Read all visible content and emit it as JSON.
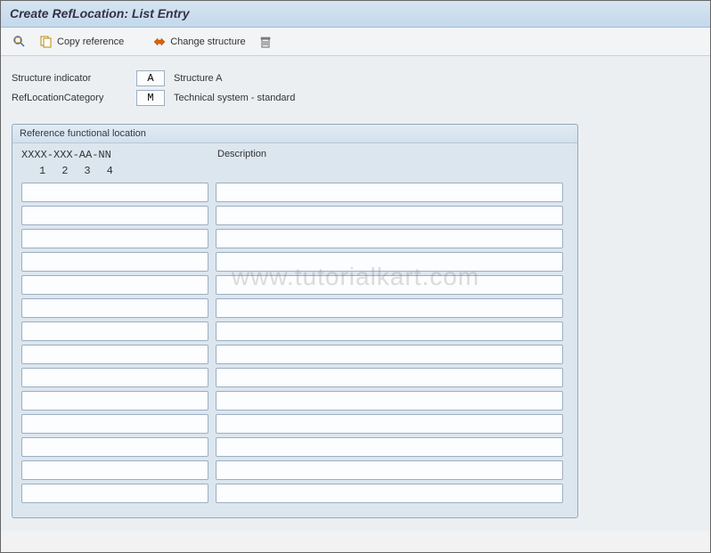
{
  "title": "Create RefLocation: List Entry",
  "toolbar": {
    "print_preview": "",
    "copy_reference": "Copy reference",
    "change_structure": "Change structure",
    "delete": ""
  },
  "form": {
    "structure_indicator": {
      "label": "Structure indicator",
      "value": "A",
      "desc": "Structure A"
    },
    "ref_location_category": {
      "label": "RefLocationCategory",
      "value": "M",
      "desc": "Technical system - standard"
    }
  },
  "groupbox": {
    "title": "Reference functional location",
    "mask": "XXXX-XXX-AA-NN",
    "segments": [
      "1",
      "2",
      "3",
      "4"
    ],
    "col_desc": "Description",
    "rows": [
      {
        "code": "",
        "desc": ""
      },
      {
        "code": "",
        "desc": ""
      },
      {
        "code": "",
        "desc": ""
      },
      {
        "code": "",
        "desc": ""
      },
      {
        "code": "",
        "desc": ""
      },
      {
        "code": "",
        "desc": ""
      },
      {
        "code": "",
        "desc": ""
      },
      {
        "code": "",
        "desc": ""
      },
      {
        "code": "",
        "desc": ""
      },
      {
        "code": "",
        "desc": ""
      },
      {
        "code": "",
        "desc": ""
      },
      {
        "code": "",
        "desc": ""
      },
      {
        "code": "",
        "desc": ""
      },
      {
        "code": "",
        "desc": ""
      }
    ]
  },
  "watermark": "www.tutorialkart.com"
}
